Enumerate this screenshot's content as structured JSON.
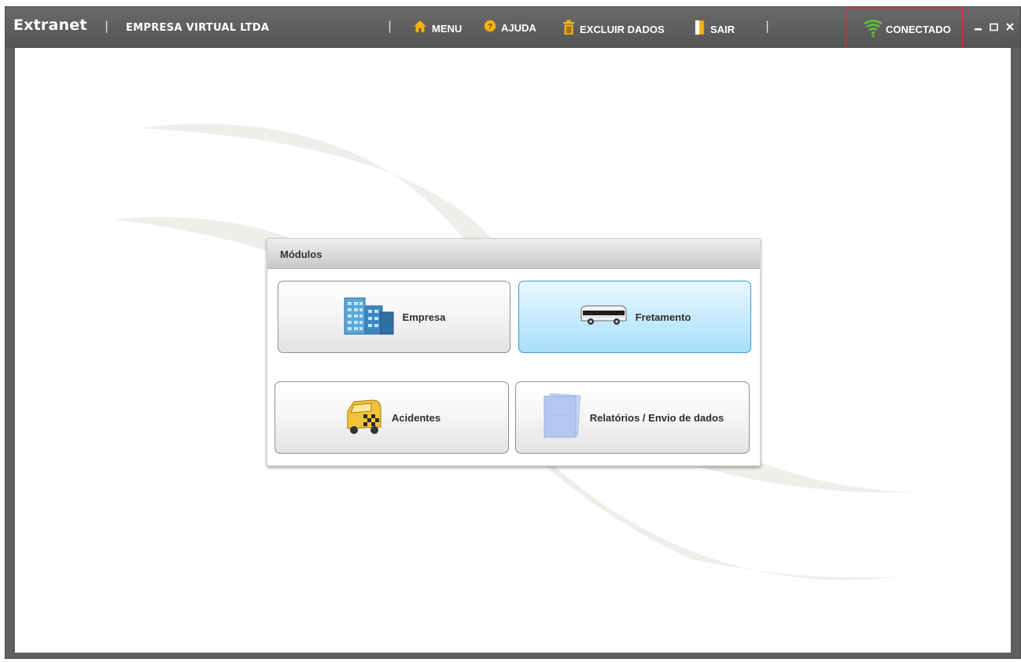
{
  "window": {
    "app_title": "Extranet",
    "separator": "|",
    "company": "EMPRESA VIRTUAL LTDA"
  },
  "toolbar": {
    "items": [
      {
        "label": "MENU",
        "icon": "home-icon"
      },
      {
        "label": "AJUDA",
        "icon": "help-icon"
      },
      {
        "label": "EXCLUIR DADOS",
        "icon": "trash-icon"
      },
      {
        "label": "SAIR",
        "icon": "exit-door-icon"
      }
    ],
    "status": {
      "label": "CONECTADO",
      "icon": "wifi-signal-icon",
      "color": "#5fc436"
    }
  },
  "modules": {
    "title": "Módulos",
    "items": [
      {
        "label": "Empresa",
        "icon": "building-icon",
        "active": false
      },
      {
        "label": "Fretamento",
        "icon": "bus-icon",
        "active": true
      },
      {
        "label": "Acidentes",
        "icon": "accident-car-icon",
        "active": false
      },
      {
        "label": "Relatórios / Envio de dados",
        "icon": "documents-icon",
        "active": false
      }
    ]
  },
  "colors": {
    "titlebar": "#5c5c5c",
    "active_button": "#c8ecfd",
    "status_border": "#d0343a",
    "home_icon": "#f2b51b",
    "help_icon": "#f2b51b"
  }
}
